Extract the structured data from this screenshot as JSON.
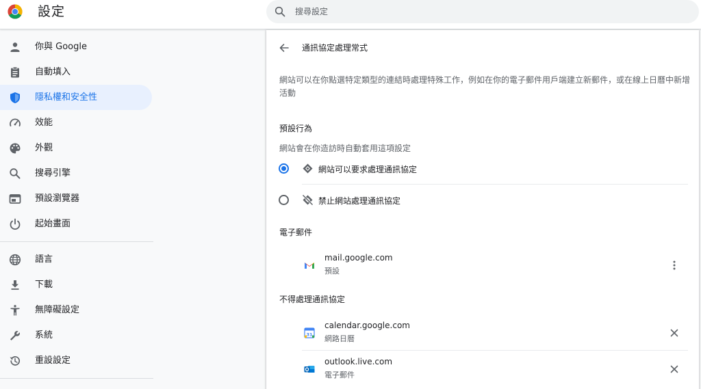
{
  "header": {
    "app_title": "設定",
    "search_placeholder": "搜尋設定"
  },
  "sidebar": {
    "items": [
      {
        "label": "你與 Google",
        "icon": "person-icon"
      },
      {
        "label": "自動填入",
        "icon": "clipboard-icon"
      },
      {
        "label": "隱私權和安全性",
        "icon": "shield-icon",
        "active": true
      },
      {
        "label": "效能",
        "icon": "speedometer-icon"
      },
      {
        "label": "外觀",
        "icon": "palette-icon"
      },
      {
        "label": "搜尋引擎",
        "icon": "search-icon"
      },
      {
        "label": "預設瀏覽器",
        "icon": "browser-icon"
      },
      {
        "label": "起始畫面",
        "icon": "power-icon"
      },
      {
        "label": "語言",
        "icon": "globe-icon"
      },
      {
        "label": "下載",
        "icon": "download-icon"
      },
      {
        "label": "無障礙設定",
        "icon": "accessibility-icon"
      },
      {
        "label": "系統",
        "icon": "wrench-icon"
      },
      {
        "label": "重設設定",
        "icon": "restore-icon"
      }
    ]
  },
  "main": {
    "title": "通訊協定處理常式",
    "description": "網站可以在你點選特定類型的連結時處理特殊工作，例如在你的電子郵件用戶端建立新郵件，或在線上日曆中新增活動",
    "default_behavior_label": "預設行為",
    "default_behavior_sub": "網站會在你造訪時自動套用這項設定",
    "options": [
      {
        "label": "網站可以要求處理通訊協定",
        "icon": "protocol-handler-icon",
        "selected": true
      },
      {
        "label": "禁止網站處理通訊協定",
        "icon": "protocol-handler-off-icon",
        "selected": false
      }
    ],
    "email_section_label": "電子郵件",
    "email_sites": [
      {
        "name": "mail.google.com",
        "sub": "預設",
        "icon": "gmail-icon",
        "action": "more-vert-icon"
      }
    ],
    "blocked_section_label": "不得處理通訊協定",
    "blocked_sites": [
      {
        "name": "calendar.google.com",
        "sub": "網路日曆",
        "icon": "google-calendar-icon",
        "action": "close-icon"
      },
      {
        "name": "outlook.live.com",
        "sub": "電子郵件",
        "icon": "outlook-icon",
        "action": "close-icon"
      }
    ]
  },
  "colors": {
    "accent": "#1a73e8",
    "active_bg": "#e8f0fe",
    "text_primary": "#202124",
    "text_secondary": "#5f6368"
  }
}
